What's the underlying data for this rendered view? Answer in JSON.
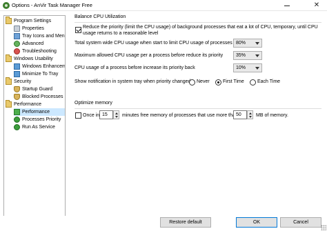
{
  "window": {
    "title": "Options - AnVir Task Manager Free",
    "close_glyph": "✕"
  },
  "tree": {
    "items": [
      {
        "label": "Program Settings",
        "level": 0,
        "icon": "folder-icon"
      },
      {
        "label": "Properties",
        "level": 1,
        "icon": "properties-icon"
      },
      {
        "label": "Tray Icons and Menu",
        "level": 1,
        "icon": "tray-icon"
      },
      {
        "label": "Advanced",
        "level": 1,
        "icon": "advanced-icon"
      },
      {
        "label": "Troubleshooting",
        "level": 1,
        "icon": "troubleshooting-icon"
      },
      {
        "label": "Windows Usability",
        "level": 0,
        "icon": "folder-icon"
      },
      {
        "label": "Windows Enhancements",
        "level": 1,
        "icon": "window-icon"
      },
      {
        "label": "Minimize To Tray",
        "level": 1,
        "icon": "window-icon"
      },
      {
        "label": "Security",
        "level": 0,
        "icon": "folder-icon"
      },
      {
        "label": "Startup Guard",
        "level": 1,
        "icon": "shield-icon"
      },
      {
        "label": "Blocked Processes",
        "level": 1,
        "icon": "shield-icon"
      },
      {
        "label": "Performance",
        "level": 0,
        "icon": "folder-icon"
      },
      {
        "label": "Performance",
        "level": 1,
        "icon": "performance-icon",
        "selected": true
      },
      {
        "label": "Processes Priority",
        "level": 1,
        "icon": "arrow-icon"
      },
      {
        "label": "Run As Service",
        "level": 1,
        "icon": "arrow-icon"
      }
    ]
  },
  "balance": {
    "heading": "Balance CPU Utilization",
    "reduce_checkbox_label": "Reduce the priority (limit the CPU usage) of background processes that eat a lot of CPU, temporary, until CPU usage returns to a reasonable level",
    "reduce_checked": true,
    "total_label": "Total system wide CPU usage when start to limit CPU usage of processes",
    "total_value": "80%",
    "max_label": "Maximum allowed CPU usage per a process before reduce its priority",
    "max_value": "35%",
    "back_label": "CPU usage of a process before increase its priority back",
    "back_value": "10%",
    "notify_label": "Show notification in system tray when priority changed:",
    "notify_options": [
      "Never",
      "First Time",
      "Each Time"
    ],
    "notify_selected": "First Time"
  },
  "optimize": {
    "heading": "Optimize memory",
    "once_label": "Once in",
    "once_checked": false,
    "minutes_value": "15",
    "middle_label": "minutes free memory of processes that use more than",
    "mb_value": "50",
    "mb_label": "MB of memory."
  },
  "buttons": {
    "restore": "Restore default",
    "ok": "OK",
    "cancel": "Cancel"
  }
}
